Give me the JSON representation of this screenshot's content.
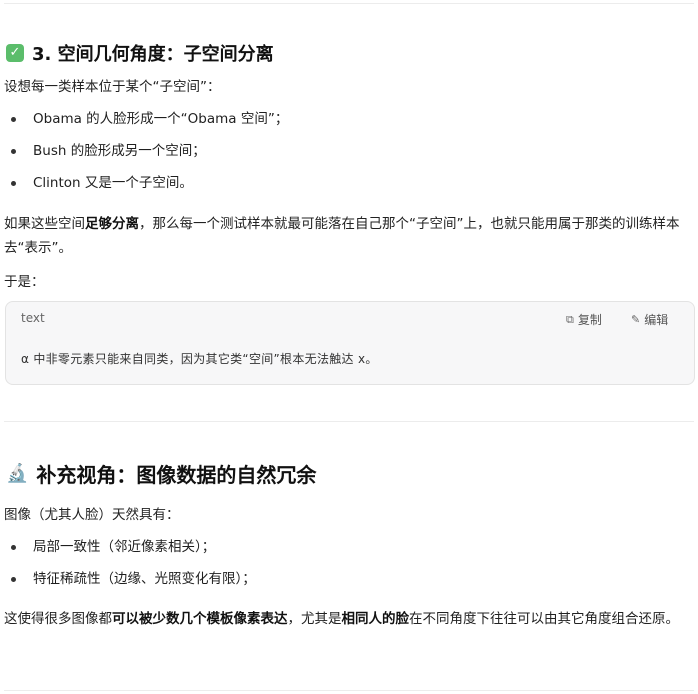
{
  "section1": {
    "emoji": "✓",
    "title": "3. 空间几何角度：子空间分离",
    "intro": "设想每一类样本位于某个“子空间”：",
    "bullets": [
      "Obama 的人脸形成一个“Obama 空间”；",
      "Bush 的脸形成另一个空间；",
      "Clinton 又是一个子空间。"
    ],
    "para_pre": "如果这些空间",
    "para_bold": "足够分离",
    "para_post": "，那么每一个测试样本就最可能落在自己那个“子空间”上，也就只能用属于那类的训练样本去“表示”。",
    "then": "于是："
  },
  "codeblock": {
    "lang": "text",
    "copy_label": "复制",
    "edit_label": "编辑",
    "code": "α 中非零元素只能来自同类，因为其它类“空间”根本无法触达 x。"
  },
  "section2": {
    "emoji": "🔬",
    "title": "补充视角：图像数据的自然冗余",
    "intro": "图像（尤其人脸）天然具有：",
    "bullets": [
      "局部一致性（邻近像素相关）；",
      "特征稀疏性（边缘、光照变化有限）；"
    ],
    "para_a": "这使得很多图像都",
    "para_b": "可以被少数几个模板像素表达",
    "para_c": "，尤其是",
    "para_d": "相同人的脸",
    "para_e": "在不同角度下往往可以由其它角度组合还原。"
  }
}
